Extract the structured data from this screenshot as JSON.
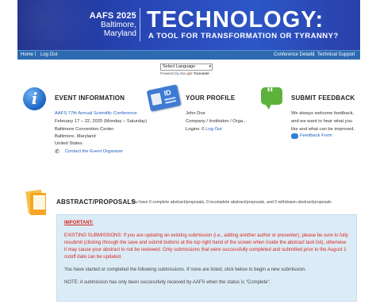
{
  "banner": {
    "year": "AAFS 2025",
    "city_line1": "Baltimore,",
    "city_line2": "Maryland",
    "title": "TECHNOLOGY:",
    "subtitle": "A TOOL FOR TRANSFORMATION OR TYRANNY?"
  },
  "nav": {
    "home": "Home",
    "logout": "Log Out",
    "conference_details": "Conference Details",
    "technical_support": "Technical Support"
  },
  "language": {
    "selected": "Select Language",
    "powered_by": "Powered by",
    "translate": "Translate"
  },
  "event": {
    "title": "EVENT INFORMATION",
    "name": "AAFS 77th Annual Scientific Conference",
    "dates": "February 17 – 22, 2025 (Monday – Saturday)",
    "venue": "Baltimore Convention Center",
    "city": "Baltimore, Maryland",
    "country": "United States",
    "contact": "Contact the Event Organizer"
  },
  "profile": {
    "title": "YOUR PROFILE",
    "id_label": "ID",
    "name": "John Doe",
    "org": "Company / Institution / Orga...",
    "logins_label": "Logins: 0",
    "logout": "Log Out"
  },
  "feedback": {
    "title": "SUBMIT FEEDBACK",
    "line1": "We always welcome feedback,",
    "line2": "and we want to hear what you",
    "line3": "like and what can be improved.",
    "link": "Feedback Form"
  },
  "abstracts": {
    "title": "ABSTRACT/PROPOSALS",
    "summary": "You have 0 complete abstract/proposals, 0 incomplete abstract/proposals, and 0 withdrawn abstract/proposals",
    "important": "IMPORTANT:",
    "existing": "EXISTING SUBMISSIONS: If you are updating an existing submission (i.e., adding another author or presenter), please be sure to fully resubmit (clicking through the save and submit buttons at the top right hand of the screen when inside the abstract task list), otherwise it may cause your abstract to not be reviewed. Only submissions that were successfully completed and submitted prior to the August 1 cutoff date can be updated.",
    "started": "You have started or completed the following submissions. If none are listed, click below to begin a new submission.",
    "note": "NOTE: A submission has only been successfully received by AAFS when the status is \"Complete\"."
  },
  "colors": {
    "banner": "#2846b5",
    "nav": "#2d6ab0",
    "link": "#1f5fbf",
    "alert": "#d7261e",
    "notice_bg": "#dcecf7"
  }
}
